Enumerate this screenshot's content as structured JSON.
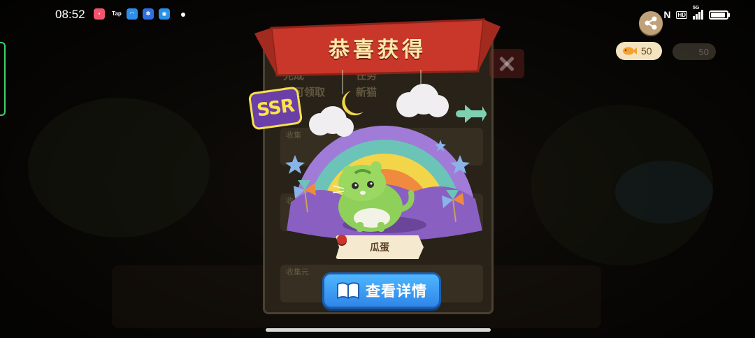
{
  "status_bar": {
    "time": "08:52",
    "notifications": [
      {
        "name": "app-notification-icon",
        "color": "#f2546d",
        "glyph": "▪"
      },
      {
        "name": "taptap-icon",
        "color": "#000000",
        "glyph": "Tap"
      },
      {
        "name": "cloud-app-icon",
        "color": "#2e8fe8",
        "glyph": "◠"
      },
      {
        "name": "baidu-icon",
        "color": "#2f6fe0",
        "glyph": "✽"
      },
      {
        "name": "circle-app-icon",
        "color": "#2a90e8",
        "glyph": "◉"
      }
    ],
    "nfc": "N",
    "hd": "HD",
    "network": "5G"
  },
  "hud": {
    "coins": "50",
    "coins_dim": "50"
  },
  "task_panel": {
    "line1": "完成",
    "line1b": "任务",
    "line2": "即可领取",
    "line2b": "新猫",
    "row_labels": [
      "收集",
      "收",
      "收集元"
    ]
  },
  "reward": {
    "title": "恭喜获得",
    "rarity": "SSR",
    "cat_name": "瓜蛋",
    "view_details_label": "查看详情"
  },
  "colors": {
    "ribbon": "#c8372a",
    "button": "#3a9bf0",
    "rainbow": [
      "#a07cd8",
      "#6cc3b8",
      "#f3d54a",
      "#f08a3e"
    ]
  }
}
